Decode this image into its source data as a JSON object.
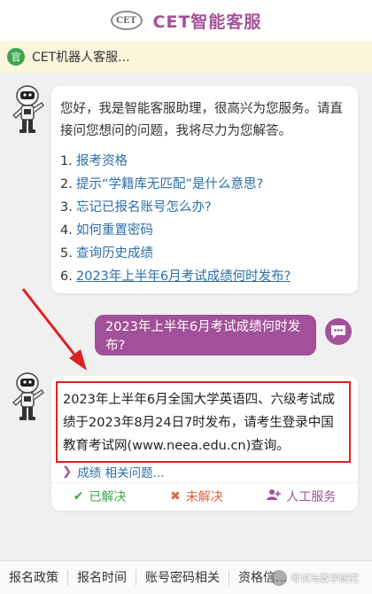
{
  "header": {
    "logo_text": "CET",
    "title": "CET智能客服"
  },
  "notice": {
    "badge": "官",
    "text": "CET机器人客服..."
  },
  "intro": {
    "text": "您好，我是智能客服助理，很高兴为您服务。请直接问您想问的问题，我将尽力为您解答。",
    "questions": [
      {
        "num": "1.",
        "text": "报考资格"
      },
      {
        "num": "2.",
        "text": "提示“学籍库无匹配”是什么意思?"
      },
      {
        "num": "3.",
        "text": "忘记已报名账号怎么办?"
      },
      {
        "num": "4.",
        "text": "如何重置密码"
      },
      {
        "num": "5.",
        "text": "查询历史成绩"
      },
      {
        "num": "6.",
        "text": "2023年上半年6月考试成绩何时发布?"
      }
    ]
  },
  "user_message": "2023年上半年6月考试成绩何时发布?",
  "answer": {
    "text": "2023年上半年6月全国大学英语四、六级考试成绩于2023年8月24日7时发布，请考生登录中国教育考试网(www.neea.edu.cn)查询。",
    "related": "成绩 相关问题...",
    "related_icon": "chevron-right-icon",
    "feedback": {
      "solved": "已解决",
      "unsolved": "未解决",
      "human": "人工服务"
    }
  },
  "bottom_nav": [
    "报名政策",
    "报名时间",
    "账号密码相关",
    "资格信..."
  ],
  "watermark": "考试与教学研究",
  "colors": {
    "brand_purple": "#a3509a",
    "link_blue": "#2e6ea8",
    "success_green": "#3ea64c",
    "warning_orange": "#e0643c",
    "highlight_red": "#e02020",
    "notice_bg": "#fbf6dc"
  }
}
